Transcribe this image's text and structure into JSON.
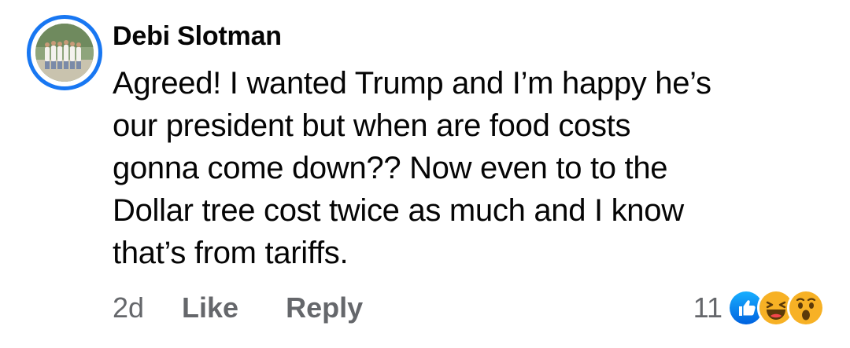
{
  "comment": {
    "author": "Debi Slotman",
    "lines": [
      "Agreed!  I wanted Trump and I’m happy he’s",
      "our president but when are food costs",
      "gonna come down??  Now even to to the",
      "Dollar tree cost twice as much and I know",
      "that’s from tariffs."
    ],
    "timestamp": "2d",
    "like_label": "Like",
    "reply_label": "Reply",
    "reaction_count": "11",
    "reactions": [
      "like-icon",
      "haha-icon",
      "wow-icon"
    ],
    "colors": {
      "accent": "#1877f2",
      "secondary_text": "#65676b",
      "emoji_yellow": "#f7b125"
    }
  }
}
